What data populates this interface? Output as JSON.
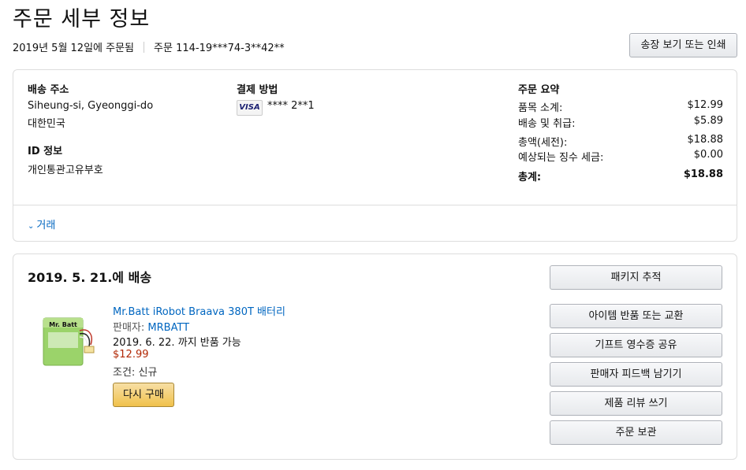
{
  "page": {
    "title": "주문 세부 정보",
    "order_date": "2019년 5월 12일에 주문됨",
    "order_number": "주문 114-19***74-3**42**",
    "invoice_button": "송장 보기 또는 인쇄"
  },
  "shipping": {
    "heading": "배송 주소",
    "line1": "Siheung-si, Gyeonggi-do",
    "line2": "대한민국"
  },
  "id_info": {
    "heading": "ID 정보",
    "value": "개인통관고유부호"
  },
  "payment": {
    "heading": "결제 방법",
    "card_brand": "VISA",
    "card_number": "**** 2**1"
  },
  "order_summary": {
    "heading": "주문 요약",
    "rows": [
      {
        "label": "품목 소계:",
        "value": "$12.99"
      },
      {
        "label": "배송 및 취급:",
        "value": "$5.89"
      },
      {
        "label": "총액(세전):",
        "value": "$18.88"
      },
      {
        "label": "예상되는 징수 세금:",
        "value": "$0.00"
      }
    ],
    "total": {
      "label": "총계:",
      "value": "$18.88"
    }
  },
  "transactions_toggle": "거래",
  "shipment": {
    "title": "2019. 5. 21.에 배송",
    "product": {
      "name": "Mr.Batt iRobot Braava 380T 배터리",
      "seller_label": "판매자: ",
      "seller_name": "MRBATT",
      "return_text": "2019. 6. 22. 까지 반품 가능",
      "price": "$12.99",
      "condition_label": "조건: ",
      "condition_value": "신규",
      "image_brand": "Mr. Batt"
    },
    "buy_again": "다시 구매",
    "actions": {
      "track": "패키지 추적",
      "return": "아이템 반품 또는 교환",
      "gift": "기프트 영수증 공유",
      "feedback": "판매자 피드백 남기기",
      "review": "제품 리뷰 쓰기",
      "archive": "주문 보관"
    }
  },
  "colors": {
    "link": "#0066c0",
    "price": "#b12704",
    "buy_again": "#f0c14b"
  }
}
